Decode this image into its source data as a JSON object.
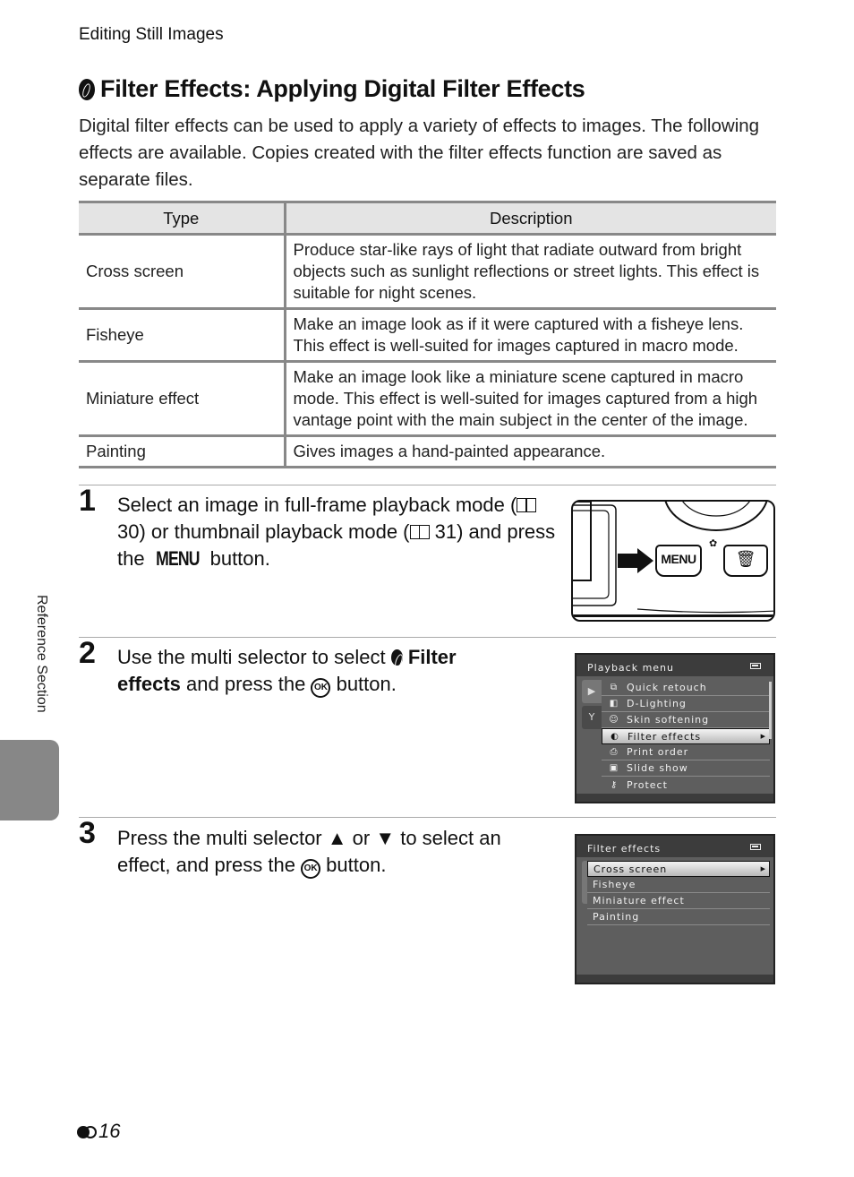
{
  "running_head": "Editing Still Images",
  "section": {
    "icon": "filter-effects-icon",
    "title": "Filter Effects: Applying Digital Filter Effects",
    "intro": "Digital filter effects can be used to apply a variety of effects to images. The following effects are available. Copies created with the filter effects function are saved as separate files."
  },
  "table": {
    "headers": [
      "Type",
      "Description"
    ],
    "rows": [
      {
        "type": "Cross screen",
        "description": "Produce star-like rays of light that radiate outward from bright objects such as sunlight reflections or street lights. This effect is suitable for night scenes."
      },
      {
        "type": "Fisheye",
        "description": "Make an image look as if it were captured with a fisheye lens. This effect is well-suited for images captured in macro mode."
      },
      {
        "type": "Miniature effect",
        "description": "Make an image look like a miniature scene captured in macro mode. This effect is well-suited for images captured from a high vantage point with the main subject in the center of the image."
      },
      {
        "type": "Painting",
        "description": "Gives images a hand-painted appearance."
      }
    ]
  },
  "steps": [
    {
      "number": "1",
      "text_a": "Select an image in full-frame playback mode (",
      "ref_a": " 30) or thumbnail playback mode (",
      "ref_b": " 31) and press the ",
      "menu_word": "MENU",
      "text_end": " button."
    },
    {
      "number": "2",
      "text_a": "Use the multi selector to select ",
      "bold": "Filter effects",
      "text_b": " and press the ",
      "ok_label": "OK",
      "text_end": " button."
    },
    {
      "number": "3",
      "text_a": "Press the multi selector ",
      "up": "▲",
      "or": " or ",
      "down": "▼",
      "text_b": " to select an effect, and press the ",
      "ok_label": "OK",
      "text_end": " button."
    }
  ],
  "camera_illustration": {
    "menu_button_label": "MENU",
    "delete_icon": "trash-icon",
    "macro_icon": "tulip-icon"
  },
  "playback_menu_screen": {
    "title": "Playback menu",
    "tabs": [
      "▶",
      "Y"
    ],
    "items": [
      {
        "icon": "⧉",
        "label": "Quick retouch"
      },
      {
        "icon": "◧",
        "label": "D-Lighting"
      },
      {
        "icon": "☺",
        "label": "Skin softening"
      },
      {
        "icon": "◐",
        "label": "Filter effects",
        "selected": true
      },
      {
        "icon": "⎙",
        "label": "Print order"
      },
      {
        "icon": "▣",
        "label": "Slide show"
      },
      {
        "icon": "⚷",
        "label": "Protect"
      }
    ]
  },
  "filter_effects_screen": {
    "title": "Filter effects",
    "items": [
      {
        "label": "Cross screen",
        "selected": true
      },
      {
        "label": "Fisheye"
      },
      {
        "label": "Miniature effect"
      },
      {
        "label": "Painting"
      }
    ]
  },
  "side_tab": "Reference Section",
  "page_number": "16"
}
